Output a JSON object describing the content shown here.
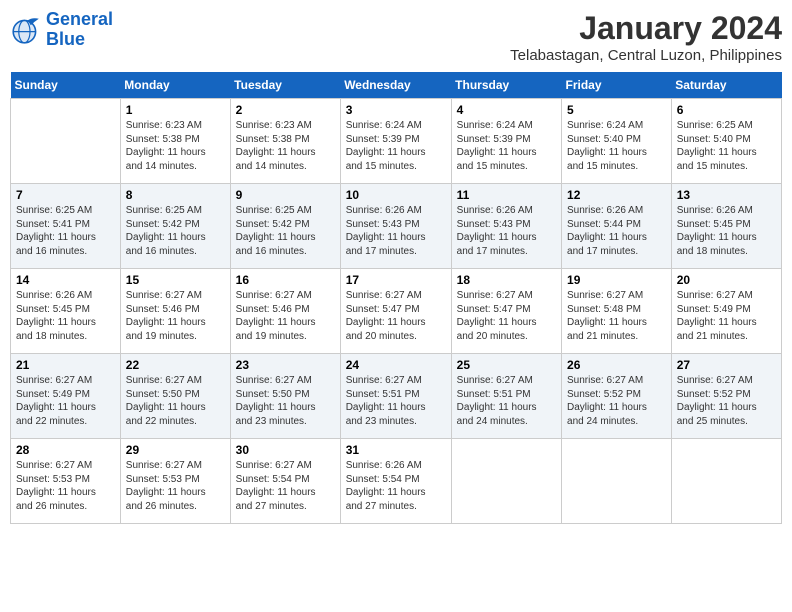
{
  "logo": {
    "line1": "General",
    "line2": "Blue"
  },
  "title": "January 2024",
  "location": "Telabastagan, Central Luzon, Philippines",
  "headers": [
    "Sunday",
    "Monday",
    "Tuesday",
    "Wednesday",
    "Thursday",
    "Friday",
    "Saturday"
  ],
  "weeks": [
    [
      {
        "day": "",
        "info": ""
      },
      {
        "day": "1",
        "info": "Sunrise: 6:23 AM\nSunset: 5:38 PM\nDaylight: 11 hours\nand 14 minutes."
      },
      {
        "day": "2",
        "info": "Sunrise: 6:23 AM\nSunset: 5:38 PM\nDaylight: 11 hours\nand 14 minutes."
      },
      {
        "day": "3",
        "info": "Sunrise: 6:24 AM\nSunset: 5:39 PM\nDaylight: 11 hours\nand 15 minutes."
      },
      {
        "day": "4",
        "info": "Sunrise: 6:24 AM\nSunset: 5:39 PM\nDaylight: 11 hours\nand 15 minutes."
      },
      {
        "day": "5",
        "info": "Sunrise: 6:24 AM\nSunset: 5:40 PM\nDaylight: 11 hours\nand 15 minutes."
      },
      {
        "day": "6",
        "info": "Sunrise: 6:25 AM\nSunset: 5:40 PM\nDaylight: 11 hours\nand 15 minutes."
      }
    ],
    [
      {
        "day": "7",
        "info": "Sunrise: 6:25 AM\nSunset: 5:41 PM\nDaylight: 11 hours\nand 16 minutes."
      },
      {
        "day": "8",
        "info": "Sunrise: 6:25 AM\nSunset: 5:42 PM\nDaylight: 11 hours\nand 16 minutes."
      },
      {
        "day": "9",
        "info": "Sunrise: 6:25 AM\nSunset: 5:42 PM\nDaylight: 11 hours\nand 16 minutes."
      },
      {
        "day": "10",
        "info": "Sunrise: 6:26 AM\nSunset: 5:43 PM\nDaylight: 11 hours\nand 17 minutes."
      },
      {
        "day": "11",
        "info": "Sunrise: 6:26 AM\nSunset: 5:43 PM\nDaylight: 11 hours\nand 17 minutes."
      },
      {
        "day": "12",
        "info": "Sunrise: 6:26 AM\nSunset: 5:44 PM\nDaylight: 11 hours\nand 17 minutes."
      },
      {
        "day": "13",
        "info": "Sunrise: 6:26 AM\nSunset: 5:45 PM\nDaylight: 11 hours\nand 18 minutes."
      }
    ],
    [
      {
        "day": "14",
        "info": "Sunrise: 6:26 AM\nSunset: 5:45 PM\nDaylight: 11 hours\nand 18 minutes."
      },
      {
        "day": "15",
        "info": "Sunrise: 6:27 AM\nSunset: 5:46 PM\nDaylight: 11 hours\nand 19 minutes."
      },
      {
        "day": "16",
        "info": "Sunrise: 6:27 AM\nSunset: 5:46 PM\nDaylight: 11 hours\nand 19 minutes."
      },
      {
        "day": "17",
        "info": "Sunrise: 6:27 AM\nSunset: 5:47 PM\nDaylight: 11 hours\nand 20 minutes."
      },
      {
        "day": "18",
        "info": "Sunrise: 6:27 AM\nSunset: 5:47 PM\nDaylight: 11 hours\nand 20 minutes."
      },
      {
        "day": "19",
        "info": "Sunrise: 6:27 AM\nSunset: 5:48 PM\nDaylight: 11 hours\nand 21 minutes."
      },
      {
        "day": "20",
        "info": "Sunrise: 6:27 AM\nSunset: 5:49 PM\nDaylight: 11 hours\nand 21 minutes."
      }
    ],
    [
      {
        "day": "21",
        "info": "Sunrise: 6:27 AM\nSunset: 5:49 PM\nDaylight: 11 hours\nand 22 minutes."
      },
      {
        "day": "22",
        "info": "Sunrise: 6:27 AM\nSunset: 5:50 PM\nDaylight: 11 hours\nand 22 minutes."
      },
      {
        "day": "23",
        "info": "Sunrise: 6:27 AM\nSunset: 5:50 PM\nDaylight: 11 hours\nand 23 minutes."
      },
      {
        "day": "24",
        "info": "Sunrise: 6:27 AM\nSunset: 5:51 PM\nDaylight: 11 hours\nand 23 minutes."
      },
      {
        "day": "25",
        "info": "Sunrise: 6:27 AM\nSunset: 5:51 PM\nDaylight: 11 hours\nand 24 minutes."
      },
      {
        "day": "26",
        "info": "Sunrise: 6:27 AM\nSunset: 5:52 PM\nDaylight: 11 hours\nand 24 minutes."
      },
      {
        "day": "27",
        "info": "Sunrise: 6:27 AM\nSunset: 5:52 PM\nDaylight: 11 hours\nand 25 minutes."
      }
    ],
    [
      {
        "day": "28",
        "info": "Sunrise: 6:27 AM\nSunset: 5:53 PM\nDaylight: 11 hours\nand 26 minutes."
      },
      {
        "day": "29",
        "info": "Sunrise: 6:27 AM\nSunset: 5:53 PM\nDaylight: 11 hours\nand 26 minutes."
      },
      {
        "day": "30",
        "info": "Sunrise: 6:27 AM\nSunset: 5:54 PM\nDaylight: 11 hours\nand 27 minutes."
      },
      {
        "day": "31",
        "info": "Sunrise: 6:26 AM\nSunset: 5:54 PM\nDaylight: 11 hours\nand 27 minutes."
      },
      {
        "day": "",
        "info": ""
      },
      {
        "day": "",
        "info": ""
      },
      {
        "day": "",
        "info": ""
      }
    ]
  ]
}
